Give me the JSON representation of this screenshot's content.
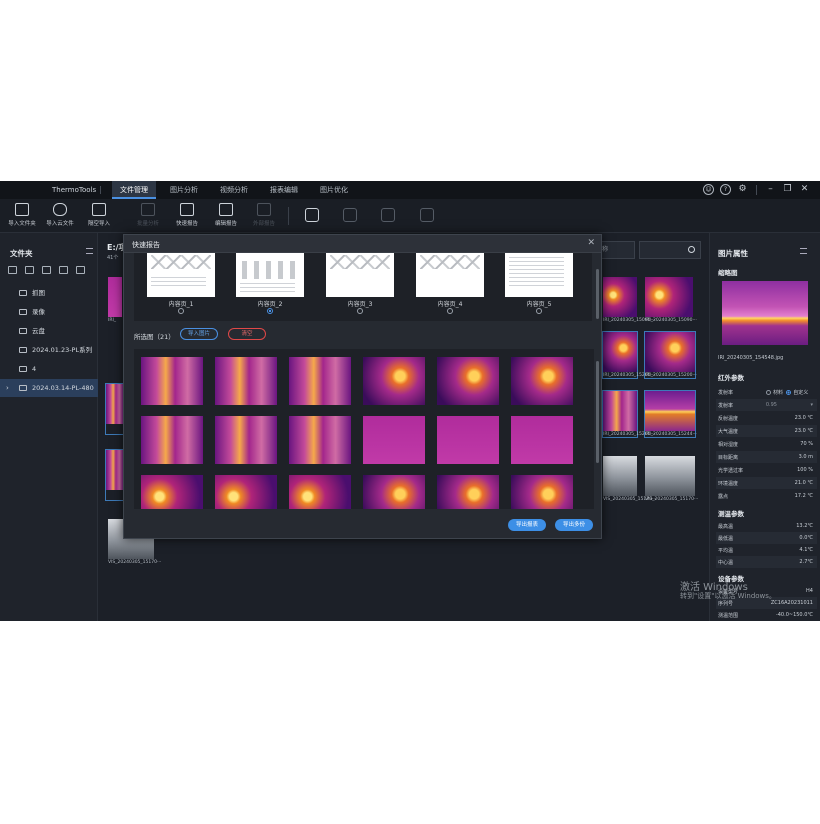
{
  "app": {
    "brand": "ThermoTools",
    "menu": [
      "文件管理",
      "图片分析",
      "视频分析",
      "报表编辑",
      "图片优化"
    ],
    "active_menu": 0
  },
  "toolbar": {
    "items": [
      {
        "label": "导入文件夹",
        "icon": "folder-import-icon",
        "enabled": true
      },
      {
        "label": "导入云文件",
        "icon": "cloud-import-icon",
        "enabled": true
      },
      {
        "label": "隔空导入",
        "icon": "airdrop-import-icon",
        "enabled": true
      },
      {
        "label": "批量分析",
        "icon": "batch-analyze-icon",
        "enabled": false
      },
      {
        "label": "快速报告",
        "icon": "quick-report-icon",
        "enabled": true
      },
      {
        "label": "编辑报告",
        "icon": "edit-report-icon",
        "enabled": true
      },
      {
        "label": "外部报告",
        "icon": "word-export-icon",
        "enabled": false
      }
    ]
  },
  "left_panel": {
    "title": "文件夹",
    "folders": [
      "抓图",
      "录像",
      "云盘",
      "2024.01.23-PL系列",
      "4",
      "2024.03.14-PL-480"
    ],
    "selected_folder": 5
  },
  "center": {
    "path": "E:/项",
    "count": "41个",
    "search_select": "称",
    "thumb_captions": [
      "IRI_",
      "IRI_20240305_15090···",
      "IRI_20240305_15090···",
      "IRI_20240305_15200···",
      "IRI_20240305_15200···",
      "IRI_20240305_15200···",
      "IRI_20240305_15244···",
      "VIS_20240305_15170···",
      "VIS_20240305_15170···",
      "VIS_20240305_15170···"
    ]
  },
  "right_panel": {
    "title": "图片属性",
    "thumb_section": "缩略图",
    "filename": "IRI_20240305_154548.jpg",
    "ir_section": "红外参数",
    "ir_params": [
      {
        "label": "发射率",
        "value": "",
        "radio": [
          "材料",
          "自定义"
        ]
      },
      {
        "label": "发射率",
        "value": "0.95"
      },
      {
        "label": "反射温度",
        "value": "23.0 ℃"
      },
      {
        "label": "大气温度",
        "value": "23.0 ℃"
      },
      {
        "label": "相对湿度",
        "value": "70 %"
      },
      {
        "label": "目标距离",
        "value": "3.0 m"
      },
      {
        "label": "光学透过率",
        "value": "100 %"
      },
      {
        "label": "环境温度",
        "value": "21.0 ℃"
      },
      {
        "label": "露点",
        "value": "17.2 ℃"
      }
    ],
    "temp_section": "测温参数",
    "temp_params": [
      {
        "label": "最高温",
        "value": "13.2℃"
      },
      {
        "label": "最低温",
        "value": "0.0℃"
      },
      {
        "label": "平均温",
        "value": "4.1℃"
      },
      {
        "label": "中心温",
        "value": "2.7℃"
      }
    ],
    "device_section": "设备参数",
    "device_params": [
      {
        "label": "设备型号",
        "value": "H4"
      },
      {
        "label": "序列号",
        "value": "ZC16A20231011"
      },
      {
        "label": "测温范围",
        "value": "-40.0~150.0℃"
      }
    ]
  },
  "watermark": {
    "line1": "激活 Windows",
    "line2": "转到\"设置\"以激活 Windows。"
  },
  "modal": {
    "title": "快速报告",
    "pages": [
      "内容页_1",
      "内容页_2",
      "内容页_3",
      "内容页_4",
      "内容页_5"
    ],
    "selected_page": 1,
    "selected_label": "所选图（21）",
    "import_button": "导入图片",
    "clear_button": "清空",
    "export_button": "导出报表",
    "export_multi_button": "导出多份"
  }
}
